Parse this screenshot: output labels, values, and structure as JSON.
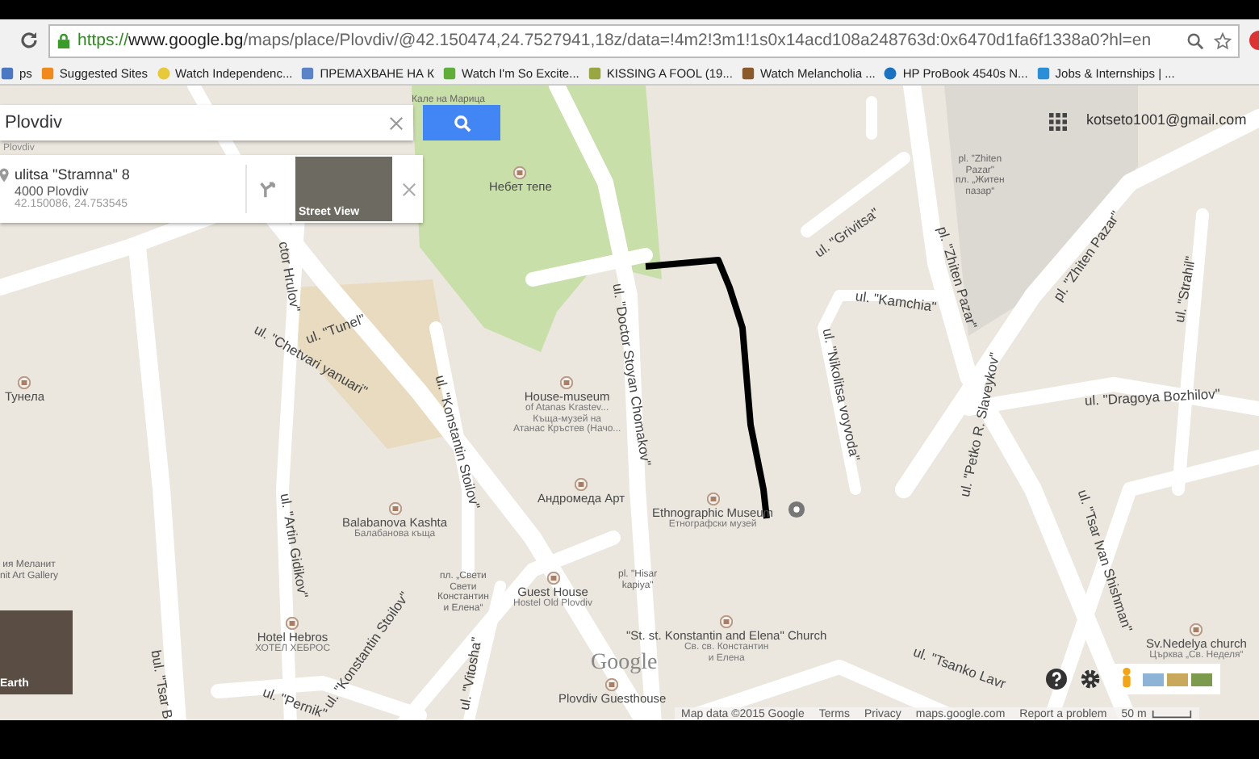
{
  "browser": {
    "url": {
      "scheme": "https://",
      "host": "www.google.bg",
      "path": "/maps/place/Plovdiv/@42.150474,24.7527941,18z/data=!4m2!3m1!1s0x14acd108a248763d:0x6470d1fa6f1338a0?hl=en"
    },
    "bookmarks": [
      {
        "label": "ps",
        "kind": "apps"
      },
      {
        "label": "Suggested Sites",
        "kind": "orange"
      },
      {
        "label": "Watch Independenc...",
        "kind": "smiley"
      },
      {
        "label": "ПРЕМАХВАНЕ НА К",
        "kind": "puzzle"
      },
      {
        "label": "Watch I'm So Excite...",
        "kind": "green"
      },
      {
        "label": "KISSING A FOOL (19...",
        "kind": "doc"
      },
      {
        "label": "Watch Melancholia ...",
        "kind": "film"
      },
      {
        "label": "HP ProBook 4540s N...",
        "kind": "hp"
      },
      {
        "label": "Jobs & Internships | ...",
        "kind": "m"
      }
    ]
  },
  "search": {
    "value": "Plovdiv",
    "under_label": "Plovdiv"
  },
  "place_card": {
    "title": "ulitsa \"Stramna\" 8",
    "address": "4000 Plovdiv",
    "coords": "42.150086, 24.753545",
    "thumbnail_label": "Street View"
  },
  "account": {
    "email": "kotseto1001@gmail.com"
  },
  "map": {
    "labels": [
      {
        "kind": "street",
        "lines": [
          "ul. \"Grivitsa\""
        ]
      },
      {
        "kind": "street",
        "lines": [
          "pl. \"Zhiten Pazar\""
        ]
      },
      {
        "kind": "street",
        "lines": [
          "pl. \"Zhiten Pazar\""
        ]
      },
      {
        "kind": "area",
        "lines": [
          "pl. \"Zhiten",
          "Pazar\"",
          "пл. „Житен",
          "пазар“"
        ]
      },
      {
        "kind": "street",
        "lines": [
          "ul. \"Strahil\""
        ]
      },
      {
        "kind": "street",
        "lines": [
          "ul. \"Kamchia\""
        ]
      },
      {
        "kind": "street",
        "lines": [
          "ul. \"Nikolitsa voyvoda\""
        ]
      },
      {
        "kind": "street",
        "lines": [
          "ul. \"Dragoya Bozhilov\""
        ]
      },
      {
        "kind": "street",
        "lines": [
          "ul. \"Petko R. Slaveykov\""
        ]
      },
      {
        "kind": "street",
        "lines": [
          "ul. \"Tsar Ivan Shishman\""
        ]
      },
      {
        "kind": "street",
        "lines": [
          "ul. \"Doctor Stoyan Chomakov\""
        ]
      },
      {
        "kind": "street",
        "lines": [
          "ctor Hrulov\""
        ]
      },
      {
        "kind": "street",
        "lines": [
          "ul. \"Tunel\""
        ]
      },
      {
        "kind": "street",
        "lines": [
          "ul. \"Chetvari yanuari\""
        ]
      },
      {
        "kind": "street",
        "lines": [
          "ul. \"Konstantin Stoilov\""
        ]
      },
      {
        "kind": "poi",
        "lines": [
          "House-museum",
          "of Atanas Krastev...",
          "Къща-музей на",
          "Атанас Кръстев (Начо..."
        ]
      },
      {
        "kind": "poi",
        "lines": [
          "Андромеда Арт"
        ]
      },
      {
        "kind": "poi",
        "lines": [
          "Balabanova Kashta",
          "Балабанова къща"
        ]
      },
      {
        "kind": "poi",
        "lines": [
          "Ethnographic Museum",
          "Етнографски музей"
        ]
      },
      {
        "kind": "area",
        "lines": [
          "pl. \"Hisar",
          "kapiya\""
        ]
      },
      {
        "kind": "street",
        "lines": [
          "ul. \"Artin Gidikov\""
        ]
      },
      {
        "kind": "poi",
        "lines": [
          "Hotel Hebros",
          "ХОТЕЛ ХЕБРОС"
        ]
      },
      {
        "kind": "street",
        "lines": [
          "ul. \"Konstantin Stoilov\""
        ]
      },
      {
        "kind": "street",
        "lines": [
          "ul. \"Pernik\""
        ]
      },
      {
        "kind": "street",
        "lines": [
          "ul. \"Vitosha\""
        ]
      },
      {
        "kind": "street",
        "lines": [
          "bul. \"Tsar B"
        ]
      },
      {
        "kind": "area",
        "lines": [
          "пл. „Свети",
          "Свети",
          "Константин",
          "и Елена“"
        ]
      },
      {
        "kind": "poi",
        "lines": [
          "Guest House",
          "Hostel Old Plovdiv"
        ]
      },
      {
        "kind": "poi",
        "lines": [
          "\"St. st. Konstantin and Elena\" Church",
          "Св. св. Константин",
          "и Елена"
        ]
      },
      {
        "kind": "poi",
        "lines": [
          "Plovdiv Guesthouse"
        ]
      },
      {
        "kind": "street",
        "lines": [
          "ul. \"Tsanko Lavr"
        ]
      },
      {
        "kind": "poi",
        "lines": [
          "Небет тепе"
        ]
      },
      {
        "kind": "area",
        "lines": [
          "Кале на Марица"
        ]
      },
      {
        "kind": "poi",
        "lines": [
          "Sv.Nedelya church",
          "Църква „Св. Неделя“"
        ]
      },
      {
        "kind": "poi",
        "lines": [
          "Тунела"
        ]
      },
      {
        "kind": "area",
        "lines": [
          "ия Меланит",
          "nit Art Gallery"
        ]
      }
    ]
  },
  "earth": {
    "label": "Earth"
  },
  "footer": {
    "logo": "Google",
    "links": [
      "Map data ©2015 Google",
      "Terms",
      "Privacy",
      "maps.google.com",
      "Report a problem"
    ],
    "scale": "50 m"
  }
}
